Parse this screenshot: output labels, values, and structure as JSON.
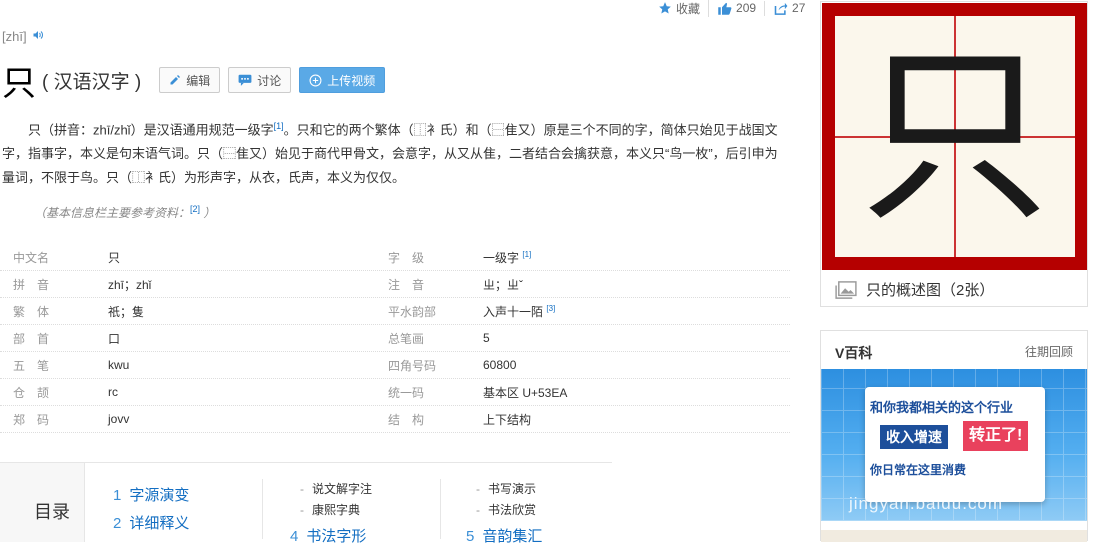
{
  "stats": {
    "collect_label": "收藏",
    "like_count": "209",
    "share_count": "27"
  },
  "pinyin": "[zhī]",
  "title": {
    "char": "只",
    "sub": "( 汉语汉字 )"
  },
  "buttons": {
    "edit": "编辑",
    "discuss": "讨论",
    "upload": "上传视频"
  },
  "summary": {
    "p1": "只（拼音：zhī/zhǐ）是汉语通用规范一级字",
    "ref1": "[1]",
    "p2": "。只和它的两个繁体（⿰衤氏）和（⿱隹又）原是三个不同的字，简体只始见于战国文字，指事字，本义是句末语气词。只（⿱隹又）始见于商代甲骨文，会意字，从又从隹，二者结合会擒获意，本义只“鸟一枚”，后引申为量词，不限于鸟。只（⿰衤氏）为形声字，从衣，氏声，本义为仅仅。"
  },
  "refnote": {
    "text": "（基本信息栏主要参考资料：",
    "ref": "[2]",
    "end": "）"
  },
  "infobox": [
    {
      "n1": "中文名",
      "v1": "只",
      "r1": "",
      "n2": "字　级",
      "v2": "一级字",
      "r2": "[1]"
    },
    {
      "n1": "拼　音",
      "v1": "zhī；zhǐ",
      "r1": "",
      "n2": "注　音",
      "v2": "ㄓ；ㄓˇ",
      "r2": ""
    },
    {
      "n1": "繁　体",
      "v1": "祇；隻",
      "r1": "",
      "n2": "平水韵部",
      "v2": "入声十一陌",
      "r2": "[3]"
    },
    {
      "n1": "部　首",
      "v1": "口",
      "r1": "",
      "n2": "总笔画",
      "v2": "5",
      "r2": ""
    },
    {
      "n1": "五　笔",
      "v1": "kwu",
      "r1": "",
      "n2": "四角号码",
      "v2": "60800",
      "r2": ""
    },
    {
      "n1": "仓　颉",
      "v1": "rc",
      "r1": "",
      "n2": "统一码",
      "v2": "基本区 U+53EA",
      "r2": ""
    },
    {
      "n1": "郑　码",
      "v1": "jovv",
      "r1": "",
      "n2": "结　构",
      "v2": "上下结构",
      "r2": ""
    }
  ],
  "toc": {
    "label": "目录",
    "items": [
      {
        "num": "1",
        "label": "字源演变"
      },
      {
        "num": "2",
        "label": "详细释义"
      },
      {
        "num": "4",
        "label": "书法字形"
      },
      {
        "num": "5",
        "label": "音韵集汇"
      }
    ],
    "subs": [
      "说文解字注",
      "康熙字典",
      "书写演示",
      "书法欣赏"
    ],
    "dash": "-"
  },
  "char_card": {
    "glyph": "只",
    "caption": "只的概述图（2张）"
  },
  "vbaike": {
    "title": "V百科",
    "more": "往期回顾",
    "line1": "和你我都相关的这个行业",
    "line2a": "收入增速",
    "line2b": "转正了!",
    "line3": "你日常在这里消费",
    "watermark": "jingyan.baidu.com"
  },
  "colors": {
    "link": "#136ec2",
    "frame_red": "#b50000",
    "btn_blue": "#5aa9e6"
  }
}
